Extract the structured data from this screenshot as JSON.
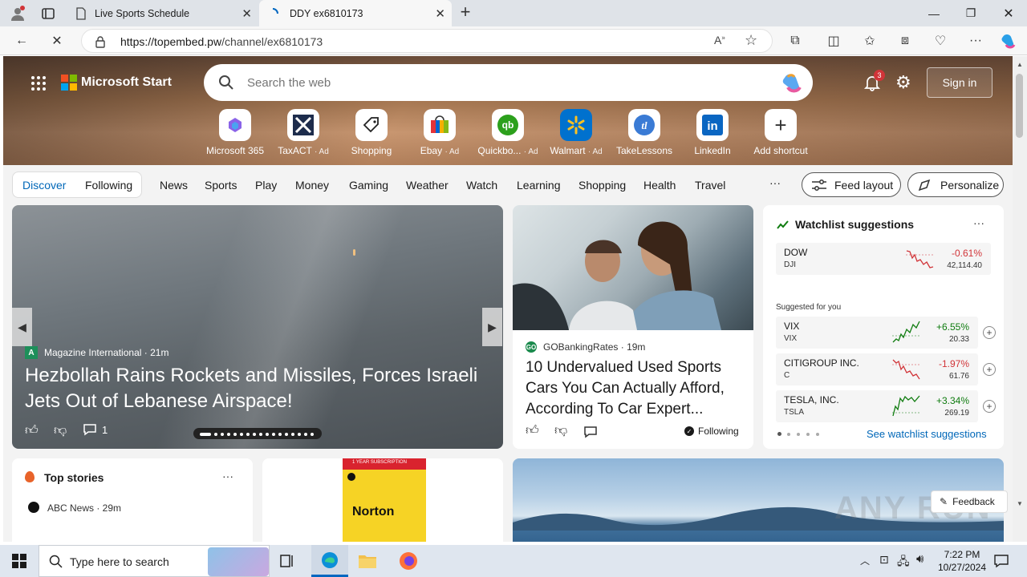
{
  "browser": {
    "tabs": [
      {
        "title": "Live Sports Schedule"
      },
      {
        "title": "DDY ex6810173"
      }
    ],
    "url_host": "https://topembed.pw",
    "url_path": "/channel/ex6810173"
  },
  "header": {
    "logo": "Microsoft Start",
    "search_placeholder": "Search the web",
    "notif_count": "3",
    "signin": "Sign in"
  },
  "shortcuts": [
    {
      "label": "Microsoft 365",
      "ad": "",
      "color": "#7a5ce0"
    },
    {
      "label": "TaxACT",
      "ad": "· Ad",
      "color": "#1d2c4c"
    },
    {
      "label": "Shopping",
      "ad": "",
      "color": "#1a1a1a"
    },
    {
      "label": "Ebay",
      "ad": "· Ad",
      "color": "#e53238"
    },
    {
      "label": "Quickbo...",
      "ad": "· Ad",
      "color": "#2ca01c"
    },
    {
      "label": "Walmart",
      "ad": "· Ad",
      "color": "#0071ce"
    },
    {
      "label": "TakeLessons",
      "ad": "",
      "color": "#3a7bd5"
    },
    {
      "label": "LinkedIn",
      "ad": "",
      "color": "#0a66c2"
    },
    {
      "label": "Add shortcut",
      "ad": "",
      "color": "#333"
    }
  ],
  "nav": {
    "discover": "Discover",
    "following": "Following",
    "items": [
      "News",
      "Sports",
      "Play",
      "Money",
      "Gaming",
      "Weather",
      "Watch",
      "Learning",
      "Shopping",
      "Health",
      "Travel"
    ],
    "more": "···",
    "feed_layout": "Feed layout",
    "personalize": "Personalize"
  },
  "main_story": {
    "source": "Magazine International",
    "time": "· 21m",
    "headline": "Hezbollah Rains Rockets and Missiles, Forces Israeli Jets Out of Lebanese Airspace!",
    "comments": "1"
  },
  "story2": {
    "source": "GOBankingRates",
    "time": "· 19m",
    "headline": "10 Undervalued Used Sports Cars You Can Actually Afford, According To Car Expert...",
    "following": "Following"
  },
  "watchlist": {
    "title": "Watchlist suggestions",
    "suggested": "Suggested for you",
    "see_more": "See watchlist suggestions",
    "stocks": [
      {
        "name": "DOW",
        "sym": "DJI",
        "pct": "-0.61%",
        "val": "42,114.40",
        "color": "#d13438"
      },
      {
        "name": "VIX",
        "sym": "VIX",
        "pct": "+6.55%",
        "val": "20.33",
        "color": "#107c10"
      },
      {
        "name": "CITIGROUP INC.",
        "sym": "C",
        "pct": "-1.97%",
        "val": "61.76",
        "color": "#d13438"
      },
      {
        "name": "TESLA, INC.",
        "sym": "TSLA",
        "pct": "+3.34%",
        "val": "269.19",
        "color": "#107c10"
      }
    ]
  },
  "top_stories": {
    "title": "Top stories",
    "source": "ABC News · 29m"
  },
  "ad_card": {
    "banner": "1 YEAR SUBSCRIPTION",
    "brand": "Norton"
  },
  "feedback": "Feedback",
  "watermark": "ANY RUN",
  "taskbar": {
    "search_placeholder": "Type here to search",
    "time": "7:22 PM",
    "date": "10/27/2024"
  }
}
